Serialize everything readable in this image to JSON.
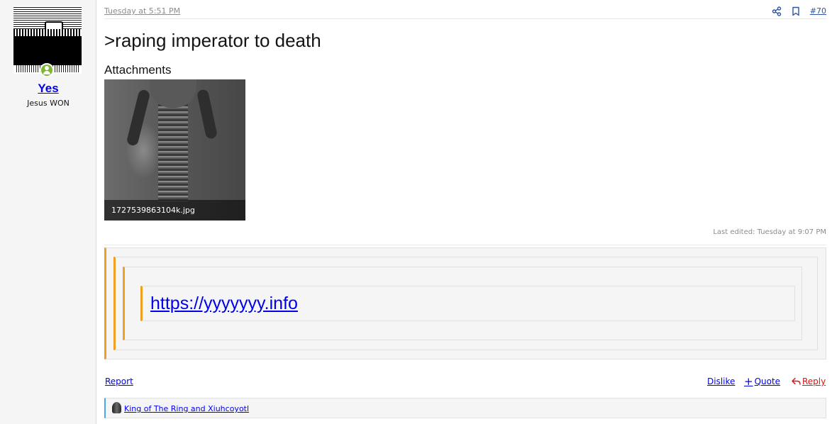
{
  "user": {
    "name": "Yes",
    "title": "Jesus WON",
    "online_color": "#7cb82f"
  },
  "post": {
    "date": "Tuesday at 5:51 PM",
    "number": "#70",
    "text": ">raping imperator to death",
    "attachments_heading": "Attachments",
    "attachment": {
      "filename": "1727539863104k.jpg"
    },
    "last_edited": "Last edited: Tuesday at 9:07 PM",
    "quote_link": "https://yyyyyyy.info",
    "quote_accent_color": "#f0a020"
  },
  "header_icons": [
    "share-icon",
    "bookmark-icon"
  ],
  "actions": {
    "report": "Report",
    "dislike": "Dislike",
    "quote": "Quote",
    "reply": "Reply"
  },
  "reactions": {
    "users": "King of The Ring and Xiuhcoyotl"
  }
}
